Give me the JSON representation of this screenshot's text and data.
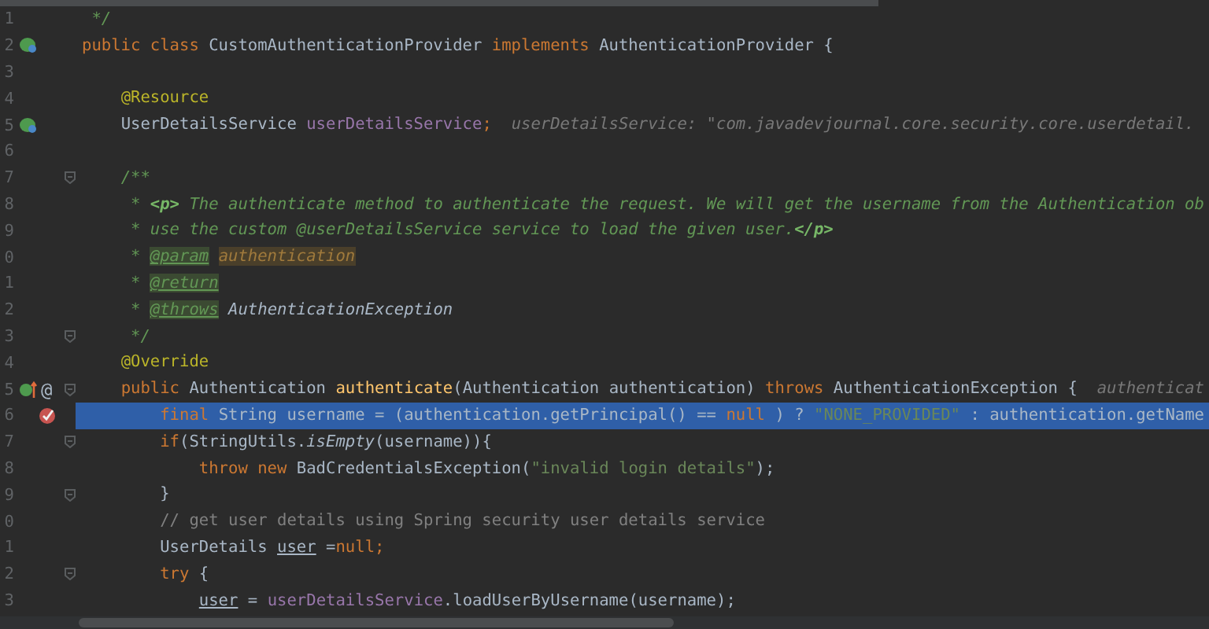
{
  "lines": [
    {
      "number": "1",
      "tokens": [
        {
          "text": " */",
          "kind": "doc"
        }
      ]
    },
    {
      "number": "2",
      "kind": "bean",
      "tokens": [
        {
          "text": "public class ",
          "kind": "keyword"
        },
        {
          "text": "CustomAuthenticationProvider ",
          "kind": "plain"
        },
        {
          "text": "implements ",
          "kind": "keyword"
        },
        {
          "text": "AuthenticationProvider {",
          "kind": "plain"
        }
      ]
    },
    {
      "number": "3"
    },
    {
      "number": "4",
      "tokens": [
        {
          "text": "    @Resource",
          "kind": "annotation"
        }
      ]
    },
    {
      "number": "5",
      "kind": "bean",
      "tokens": [
        {
          "text": "    UserDetailsService ",
          "kind": "plain"
        },
        {
          "text": "userDetailsService",
          "kind": "field"
        },
        {
          "text": ";",
          "kind": "keyword"
        },
        {
          "text": "  userDetailsService: \"com.javadevjournal.core.security.core.userdetail.",
          "kind": "hint"
        }
      ]
    },
    {
      "number": "6"
    },
    {
      "number": "7",
      "fold": true,
      "tokens": [
        {
          "text": "    /**",
          "kind": "doc"
        }
      ]
    },
    {
      "number": "8",
      "tokens": [
        {
          "text": "     * ",
          "kind": "doc"
        },
        {
          "text": "<p>",
          "kind": "doc-markup"
        },
        {
          "text": " The authenticate method to authenticate the request. We will get the username from the Authentication ob",
          "kind": "doc"
        }
      ]
    },
    {
      "number": "9",
      "tokens": [
        {
          "text": "     * use the custom @userDetailsService service to load the given user.",
          "kind": "doc"
        },
        {
          "text": "</p>",
          "kind": "doc-markup"
        }
      ]
    },
    {
      "number": "0",
      "tokens": [
        {
          "text": "     * ",
          "kind": "doc"
        },
        {
          "text": "@param",
          "kind": "doc-tag"
        },
        {
          "text": " authentication",
          "kind": "doc-param"
        }
      ]
    },
    {
      "number": "1",
      "tokens": [
        {
          "text": "     * ",
          "kind": "doc"
        },
        {
          "text": "@return",
          "kind": "doc-tag"
        }
      ]
    },
    {
      "number": "2",
      "tokens": [
        {
          "text": "     * ",
          "kind": "doc"
        },
        {
          "text": "@throws",
          "kind": "doc-tag"
        },
        {
          "text": " AuthenticationException",
          "kind": "doc-type"
        }
      ]
    },
    {
      "number": "3",
      "fold": true,
      "tokens": [
        {
          "text": "     */",
          "kind": "doc"
        }
      ]
    },
    {
      "number": "4",
      "tokens": [
        {
          "text": "    @Override",
          "kind": "annotation"
        }
      ]
    },
    {
      "number": "5",
      "kind": "override",
      "mark": "@",
      "fold": true,
      "tokens": [
        {
          "text": "    public ",
          "kind": "keyword"
        },
        {
          "text": "Authentication ",
          "kind": "plain"
        },
        {
          "text": "authenticate",
          "kind": "method"
        },
        {
          "text": "(Authentication authentication) ",
          "kind": "plain"
        },
        {
          "text": "throws ",
          "kind": "keyword"
        },
        {
          "text": "AuthenticationException {",
          "kind": "plain"
        },
        {
          "text": "  authenticat",
          "kind": "hint"
        }
      ]
    },
    {
      "number": "6",
      "kind": "breakpoint",
      "highlighted": true,
      "tokens": [
        {
          "text": "        final ",
          "kind": "keyword"
        },
        {
          "text": "String username = (authentication.getPrincipal() == ",
          "kind": "plain"
        },
        {
          "text": "null ",
          "kind": "keyword"
        },
        {
          "text": ") ? ",
          "kind": "plain"
        },
        {
          "text": "\"NONE_PROVIDED\"",
          "kind": "string"
        },
        {
          "text": " : authentication.getName",
          "kind": "plain"
        }
      ]
    },
    {
      "number": "7",
      "fold": true,
      "tokens": [
        {
          "text": "        if",
          "kind": "keyword"
        },
        {
          "text": "(StringUtils.",
          "kind": "plain"
        },
        {
          "text": "isEmpty",
          "kind": "static"
        },
        {
          "text": "(username)){",
          "kind": "plain"
        }
      ]
    },
    {
      "number": "8",
      "tokens": [
        {
          "text": "            throw new ",
          "kind": "keyword"
        },
        {
          "text": "BadCredentialsException(",
          "kind": "plain"
        },
        {
          "text": "\"invalid login details\"",
          "kind": "string"
        },
        {
          "text": ");",
          "kind": "plain"
        }
      ]
    },
    {
      "number": "9",
      "fold": true,
      "tokens": [
        {
          "text": "        }",
          "kind": "plain"
        }
      ]
    },
    {
      "number": "0",
      "tokens": [
        {
          "text": "        // get user details using Spring security user details service",
          "kind": "comment"
        }
      ]
    },
    {
      "number": "1",
      "tokens": [
        {
          "text": "        UserDetails ",
          "kind": "plain"
        },
        {
          "text": "user",
          "kind": "underlined"
        },
        {
          "text": " =",
          "kind": "plain"
        },
        {
          "text": "null;",
          "kind": "keyword"
        }
      ]
    },
    {
      "number": "2",
      "fold": true,
      "tokens": [
        {
          "text": "        try ",
          "kind": "keyword"
        },
        {
          "text": "{",
          "kind": "plain"
        }
      ]
    },
    {
      "number": "3",
      "tokens": [
        {
          "text": "            user",
          "kind": "underlined"
        },
        {
          "text": " = ",
          "kind": "plain"
        },
        {
          "text": "userDetailsService",
          "kind": "field"
        },
        {
          "text": ".loadUserByUsername(username);",
          "kind": "plain"
        }
      ]
    }
  ]
}
